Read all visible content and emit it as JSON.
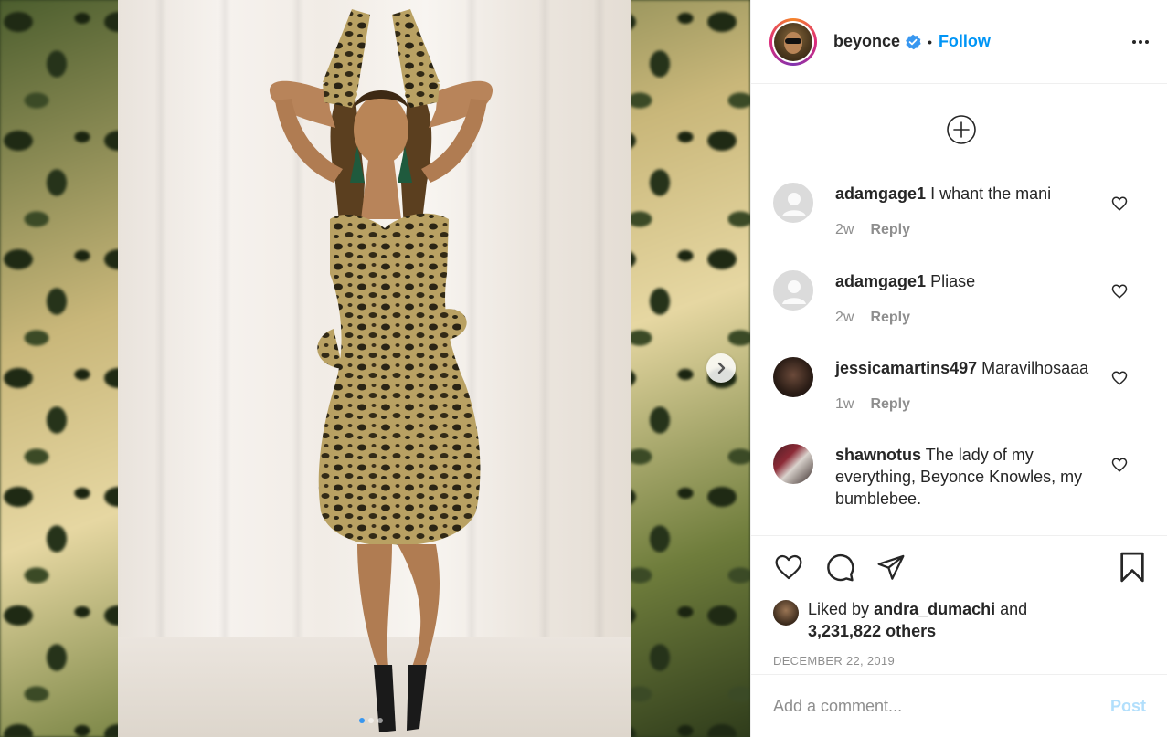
{
  "post": {
    "username": "beyonce",
    "verified": true,
    "separator": "•",
    "follow_label": "Follow",
    "more_icon": "more-options-icon",
    "image_count": 3,
    "active_image": 1
  },
  "comments": [
    {
      "username": "adamgage1",
      "text": "I whant the mani",
      "age": "2w",
      "reply_label": "Reply",
      "avatar": "default"
    },
    {
      "username": "adamgage1",
      "text": "Pliase",
      "age": "2w",
      "reply_label": "Reply",
      "avatar": "default"
    },
    {
      "username": "jessicamartins497",
      "text": "Maravilhosaaa",
      "age": "1w",
      "reply_label": "Reply",
      "avatar": "photo"
    },
    {
      "username": "shawnotus",
      "text": "The lady of my everything, Beyonce Knowles, my bumblebee.",
      "age": "",
      "reply_label": "",
      "avatar": "photo"
    }
  ],
  "actions": {
    "like_icon": "heart-icon",
    "comment_icon": "comment-icon",
    "share_icon": "paper-plane-icon",
    "save_icon": "bookmark-icon"
  },
  "likes": {
    "prefix": "Liked by",
    "first_user": "andra_dumachi",
    "conjunction": "and",
    "others": "3,231,822 others"
  },
  "date": "DECEMBER 22, 2019",
  "composer": {
    "placeholder": "Add a comment...",
    "post_label": "Post"
  },
  "colors": {
    "accent": "#0095f6",
    "post_disabled": "#b2dffc",
    "muted": "#8e8e8e",
    "verified": "#3897f0"
  }
}
